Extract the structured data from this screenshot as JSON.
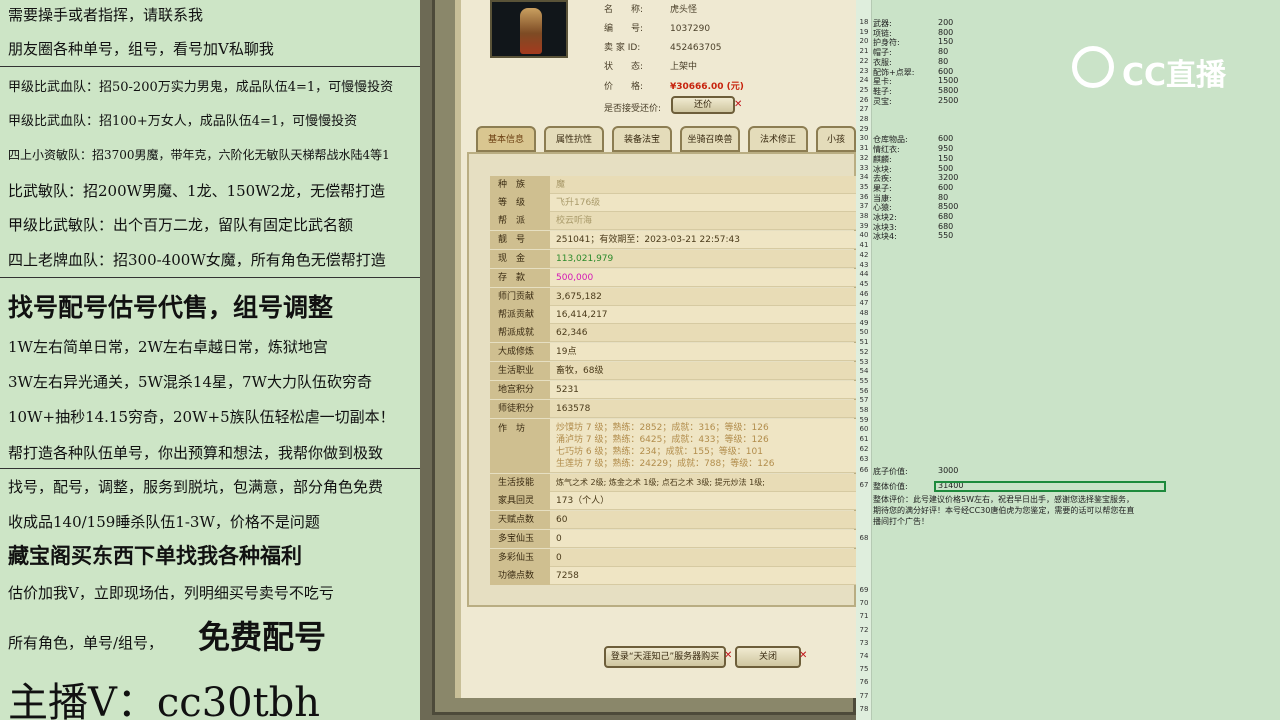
{
  "left": {
    "lines": [
      "需要操手或者指挥，请联系我",
      "朋友圈各种单号，组号，看号加V私聊我",
      "甲级比武血队：招50-200万实力男鬼，成品队伍4=1，可慢慢投资",
      "甲级比武血队：招100+万女人，成品队伍4=1，可慢慢投资",
      "四上小资敏队：招3700男魔，带年克，六阶化无敏队天梯帮战水陆4等1",
      "比武敏队：招200W男魔、1龙、150W2龙，无偿帮打造",
      "甲级比武敏队：出个百万二龙，留队有固定比武名额",
      "四上老牌血队：招300-400W女魔，所有角色无偿帮打造",
      "找号配号估号代售，组号调整",
      "1W左右简单日常，2W左右卓越日常，炼狱地宫",
      "3W左右异光通关，5W混杀14星，7W大力队伍砍穷奇",
      "10W+抽秒14.15穷奇，20W+5族队伍轻松虐一切副本！",
      "帮打造各种队伍单号，你出预算和想法，我帮你做到极致",
      "找号，配号，调整，服务到脱坑，包满意，部分角色免费",
      "收成品140/159睡杀队伍1-3W，价格不是问题",
      "藏宝阁买东西下单找我各种福利",
      "估价加我V，立即现场估，列明细买号卖号不吃亏",
      "所有角色，单号/组号，",
      "免费配号",
      "主播V：cc30tbh"
    ]
  },
  "game": {
    "info": [
      {
        "k": "名　　称:",
        "v": "虎头怪"
      },
      {
        "k": "编　　号:",
        "v": "1037290"
      },
      {
        "k": "卖 家 ID:",
        "v": "452463705"
      },
      {
        "k": "状　　态:",
        "v": "上架中"
      },
      {
        "k": "价　　格:",
        "v": "¥30666.00 (元)"
      }
    ],
    "bargain_label": "是否接受还价:",
    "bargain_btn": "还价",
    "tabs": [
      "基本信息",
      "属性抗性",
      "装备法宝",
      "坐骑召唤兽",
      "法术修正",
      "小孩"
    ],
    "rows": [
      {
        "k": "种　族",
        "v": "魔",
        "cls": "dim"
      },
      {
        "k": "等　级",
        "v": "飞升176级",
        "cls": "dim"
      },
      {
        "k": "帮　派",
        "v": "校云听海",
        "cls": "dim"
      },
      {
        "k": "靓　号",
        "v": "251041；有效期至：2023-03-21 22:57:43",
        "cls": ""
      },
      {
        "k": "现　金",
        "v": "113,021,979",
        "cls": "grn"
      },
      {
        "k": "存　款",
        "v": "500,000",
        "cls": "mag"
      },
      {
        "k": "师门贡献",
        "v": "3,675,182",
        "cls": ""
      },
      {
        "k": "帮派贡献",
        "v": "16,414,217",
        "cls": ""
      },
      {
        "k": "帮派成就",
        "v": "62,346",
        "cls": ""
      },
      {
        "k": "大成修炼",
        "v": "19点",
        "cls": ""
      },
      {
        "k": "生活职业",
        "v": "畜牧，68级",
        "cls": ""
      },
      {
        "k": "地宫积分",
        "v": "5231",
        "cls": ""
      },
      {
        "k": "师徒积分",
        "v": "163578",
        "cls": ""
      }
    ],
    "workshop_label": "作　坊",
    "workshop": [
      "炒馍坊 7 级；熟练：2852；成就：316；等级：126",
      "涌泸坊 7 级；熟练：6425；成就：433；等级：126",
      "七巧坊 6 级；熟练：234；成就：155；等级：101",
      "生莲坊 7 级；熟练：24229；成就：788；等级：126"
    ],
    "rows2": [
      {
        "k": "生活技能",
        "v": "炼气之术 2级; 炼金之术 1级; 点石之术 3级; 提元炒法 1级;"
      },
      {
        "k": "家具回灵",
        "v": "173（个人）"
      },
      {
        "k": "天赋点数",
        "v": "60"
      },
      {
        "k": "多宝仙玉",
        "v": "0"
      },
      {
        "k": "多彩仙玉",
        "v": "0"
      },
      {
        "k": "功德点数",
        "v": "7258"
      }
    ],
    "login_btn": "登录“天涯知己”服务器购买",
    "close_btn": "关闭"
  },
  "sheet": {
    "rows": [
      {
        "n": "18",
        "a": "武器:",
        "b": "200"
      },
      {
        "n": "19",
        "a": "项链:",
        "b": "800"
      },
      {
        "n": "20",
        "a": "护身符:",
        "b": "150"
      },
      {
        "n": "21",
        "a": "帽子:",
        "b": "80"
      },
      {
        "n": "22",
        "a": "衣服:",
        "b": "80"
      },
      {
        "n": "23",
        "a": "配饰+点翠:",
        "b": "600"
      },
      {
        "n": "24",
        "a": "星卡:",
        "b": "1500"
      },
      {
        "n": "25",
        "a": "鞋子:",
        "b": "5800"
      },
      {
        "n": "26",
        "a": "灵宝:",
        "b": "2500"
      },
      {
        "n": "27",
        "a": "",
        "b": ""
      },
      {
        "n": "28",
        "a": "",
        "b": ""
      },
      {
        "n": "29",
        "a": "",
        "b": ""
      },
      {
        "n": "30",
        "a": "仓库物品:",
        "b": "600"
      },
      {
        "n": "31",
        "a": "情红衣:",
        "b": "950"
      },
      {
        "n": "32",
        "a": "麒麟:",
        "b": "150"
      },
      {
        "n": "33",
        "a": "冰块:",
        "b": "500"
      },
      {
        "n": "34",
        "a": "去疾:",
        "b": "3200"
      },
      {
        "n": "35",
        "a": "果子:",
        "b": "600"
      },
      {
        "n": "36",
        "a": "当康:",
        "b": "80"
      },
      {
        "n": "37",
        "a": "心猿:",
        "b": "8500"
      },
      {
        "n": "38",
        "a": "冰块2:",
        "b": "680"
      },
      {
        "n": "39",
        "a": "冰块3:",
        "b": "680"
      },
      {
        "n": "40",
        "a": "冰块4:",
        "b": "550"
      }
    ],
    "extra_nums": [
      "41",
      "42",
      "43",
      "44",
      "45",
      "46",
      "47",
      "48",
      "49",
      "50",
      "51",
      "52",
      "53",
      "54",
      "55",
      "56",
      "57",
      "58",
      "59",
      "60",
      "61",
      "62",
      "63",
      "64",
      "65"
    ],
    "base_label": "底子价值:",
    "base_value": "3000",
    "total_label": "整体价值:",
    "total_value": "31400",
    "comment": [
      "整体评价：此号建议价格5W左右，祝君早日出手，感谢您选择鉴宝服务，",
      "期待您的满分好评！本号经CC30唐伯虎为您鉴定，需要的话可以帮您在直",
      "播间打个广告！"
    ],
    "n66": "66",
    "n67": "67",
    "n68": "68",
    "tail_nums": [
      "69",
      "70",
      "71",
      "72",
      "73",
      "74",
      "75",
      "76",
      "77",
      "78"
    ],
    "logo_text": "CC直播"
  }
}
